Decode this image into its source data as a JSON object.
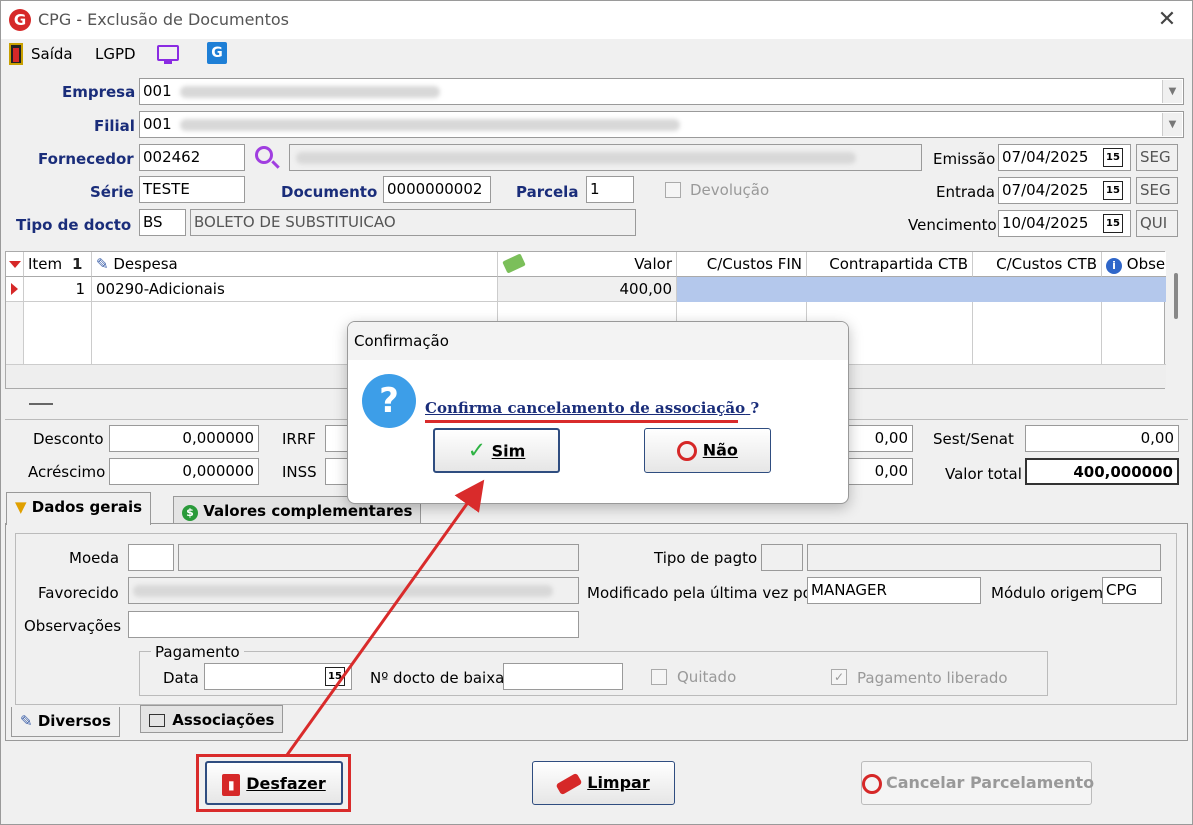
{
  "window": {
    "title": "CPG - Exclusão de Documentos",
    "close": "✕"
  },
  "menu": {
    "saida": "Saída",
    "lgpd": "LGPD"
  },
  "form": {
    "empresa_label": "Empresa",
    "empresa_code": "001",
    "filial_label": "Filial",
    "filial_code": "001",
    "fornecedor_label": "Fornecedor",
    "fornecedor_code": "002462",
    "serie_label": "Série",
    "serie_value": "TESTE",
    "documento_label": "Documento",
    "documento_value": "0000000002",
    "parcela_label": "Parcela",
    "parcela_value": "1",
    "devolucao_label": "Devolução",
    "tipo_label": "Tipo de docto",
    "tipo_code": "BS",
    "tipo_desc": "BOLETO DE SUBSTITUICAO",
    "emissao_label": "Emissão",
    "emissao_value": "07/04/2025",
    "emissao_day": "SEG",
    "entrada_label": "Entrada",
    "entrada_value": "07/04/2025",
    "entrada_day": "SEG",
    "vencimento_label": "Vencimento",
    "vencimento_value": "10/04/2025",
    "vencimento_day": "QUI"
  },
  "grid": {
    "headers": {
      "item": "Item",
      "despesa": "Despesa",
      "valor": "Valor",
      "ccfin": "C/Custos FIN",
      "contra": "Contrapartida CTB",
      "ccctb": "C/Custos CTB",
      "obs": "Obse"
    },
    "rows": [
      {
        "item": "1",
        "despesa": "00290-Adicionais",
        "valor": "400,00"
      }
    ]
  },
  "totals": {
    "desconto_label": "Desconto",
    "desconto_value": "0,000000",
    "acrescimo_label": "Acréscimo",
    "acrescimo_value": "0,000000",
    "irrf_label": "IRRF",
    "inss_label": "INSS",
    "mid1_value": "0,00",
    "mid2_value": "0,00",
    "sest_label": "Sest/Senat",
    "sest_value": "0,00",
    "total_label": "Valor total",
    "total_value": "400,000000"
  },
  "tabs": {
    "dados_gerais": "Dados gerais",
    "valores_complementares": "Valores complementares",
    "diversos": "Diversos",
    "associacoes": "Associações"
  },
  "details": {
    "moeda_label": "Moeda",
    "favorecido_label": "Favorecido",
    "observacoes_label": "Observações",
    "tipo_pagto_label": "Tipo de pagto",
    "modificado_label": "Modificado pela última vez por",
    "modificado_value": "MANAGER",
    "modulo_label": "Módulo origem",
    "modulo_value": "CPG",
    "pagamento_legend": "Pagamento",
    "data_label": "Data",
    "data_value": " /  /",
    "baixa_label": "Nº docto de baixa",
    "quitado_label": "Quitado",
    "liberado_label": "Pagamento liberado"
  },
  "buttons": {
    "desfazer": "Desfazer",
    "limpar": "Limpar",
    "cancelar": "Cancelar Parcelamento"
  },
  "dialog": {
    "title": "Confirmação",
    "message": "Confirma cancelamento de associação",
    "question_mark": "?",
    "yes": "Sim",
    "no": "Não"
  },
  "icons": {
    "calendar": "15",
    "check": "✓"
  },
  "colors": {
    "highlight": "#d92b2b",
    "selection": "#b4c8ec",
    "label_blue": "#1a2d7a"
  }
}
